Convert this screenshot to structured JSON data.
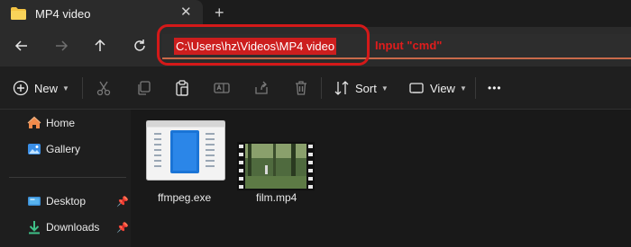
{
  "tab": {
    "title": "MP4 video",
    "folder_icon": "folder-icon",
    "close_icon": "close-icon",
    "new_tab_icon": "plus-icon"
  },
  "nav": {
    "back_icon": "arrow-left-icon",
    "forward_icon": "arrow-right-icon",
    "up_icon": "arrow-up-icon",
    "refresh_icon": "refresh-icon"
  },
  "address": {
    "value": "C:\\Users\\hz\\Videos\\MP4 video",
    "highlight_color": "#cc1e1e"
  },
  "annotation": {
    "text": "Input \"cmd\"",
    "color": "#e01c1c"
  },
  "toolbar": {
    "new_label": "New",
    "sort_label": "Sort",
    "view_label": "View",
    "more_label": "•••",
    "icons": [
      "cut-icon",
      "copy-icon",
      "paste-icon",
      "rename-icon",
      "share-icon",
      "delete-icon"
    ]
  },
  "sidebar": {
    "items": [
      {
        "label": "Home",
        "icon": "home-icon"
      },
      {
        "label": "Gallery",
        "icon": "gallery-icon"
      },
      {
        "label": "Desktop",
        "icon": "desktop-icon",
        "pinned": true
      },
      {
        "label": "Downloads",
        "icon": "download-icon",
        "pinned": true
      }
    ]
  },
  "files": [
    {
      "name": "ffmpeg.exe",
      "icon": "exe-file-icon"
    },
    {
      "name": "film.mp4",
      "icon": "video-thumbnail"
    }
  ]
}
